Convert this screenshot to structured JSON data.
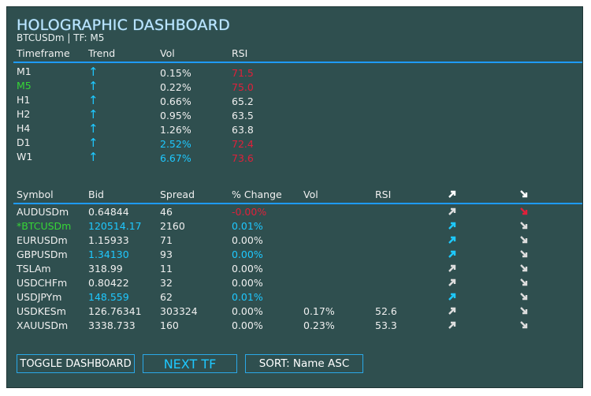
{
  "title": "HOLOGRAPHIC DASHBOARD",
  "subtitle": "BTCUSDm | TF: M5",
  "tf_table": {
    "headers": [
      "Timeframe",
      "Trend",
      "Vol",
      "RSI"
    ],
    "rows": [
      {
        "tf": "M1",
        "trend": "↑",
        "vol": "0.15%",
        "rsi": "71.5"
      },
      {
        "tf": "M5",
        "trend": "↑",
        "vol": "0.22%",
        "rsi": "75.0"
      },
      {
        "tf": "H1",
        "trend": "↑",
        "vol": "0.66%",
        "rsi": "65.2"
      },
      {
        "tf": "H2",
        "trend": "↑",
        "vol": "0.95%",
        "rsi": "63.5"
      },
      {
        "tf": "H4",
        "trend": "↑",
        "vol": "1.26%",
        "rsi": "63.8"
      },
      {
        "tf": "D1",
        "trend": "↑",
        "vol": "2.52%",
        "rsi": "72.4"
      },
      {
        "tf": "W1",
        "trend": "↑",
        "vol": "6.67%",
        "rsi": "73.6"
      }
    ]
  },
  "sym_table": {
    "headers": [
      "Symbol",
      "Bid",
      "Spread",
      "% Change",
      "Vol",
      "RSI"
    ],
    "rows": [
      {
        "sym": "AUDUSDm",
        "bid": "0.64844",
        "spread": "46",
        "chg": "-0.00%",
        "vol": "",
        "rsi": ""
      },
      {
        "sym": "*BTCUSDm",
        "bid": "120514.17",
        "spread": "2160",
        "chg": "0.01%",
        "vol": "",
        "rsi": ""
      },
      {
        "sym": "EURUSDm",
        "bid": "1.15933",
        "spread": "71",
        "chg": "0.00%",
        "vol": "",
        "rsi": ""
      },
      {
        "sym": "GBPUSDm",
        "bid": "1.34130",
        "spread": "93",
        "chg": "0.00%",
        "vol": "",
        "rsi": ""
      },
      {
        "sym": "TSLAm",
        "bid": "318.99",
        "spread": "11",
        "chg": "0.00%",
        "vol": "",
        "rsi": ""
      },
      {
        "sym": "USDCHFm",
        "bid": "0.80422",
        "spread": "32",
        "chg": "0.00%",
        "vol": "",
        "rsi": ""
      },
      {
        "sym": "USDJPYm",
        "bid": "148.559",
        "spread": "62",
        "chg": "0.01%",
        "vol": "",
        "rsi": ""
      },
      {
        "sym": "USDKESm",
        "bid": "126.76341",
        "spread": "303324",
        "chg": "0.00%",
        "vol": "0.17%",
        "rsi": "52.6"
      },
      {
        "sym": "XAUUSDm",
        "bid": "3338.733",
        "spread": "160",
        "chg": "0.00%",
        "vol": "0.23%",
        "rsi": "53.3"
      }
    ]
  },
  "buttons": {
    "toggle": "TOGGLE DASHBOARD",
    "next": "NEXT TF",
    "sort": "SORT: Name ASC"
  },
  "colors": {
    "panel": "#2f4f4f",
    "accent_blue": "#1e9bff",
    "cyan": "#1ec8ff",
    "red": "#e0203a",
    "green": "#36d636"
  }
}
